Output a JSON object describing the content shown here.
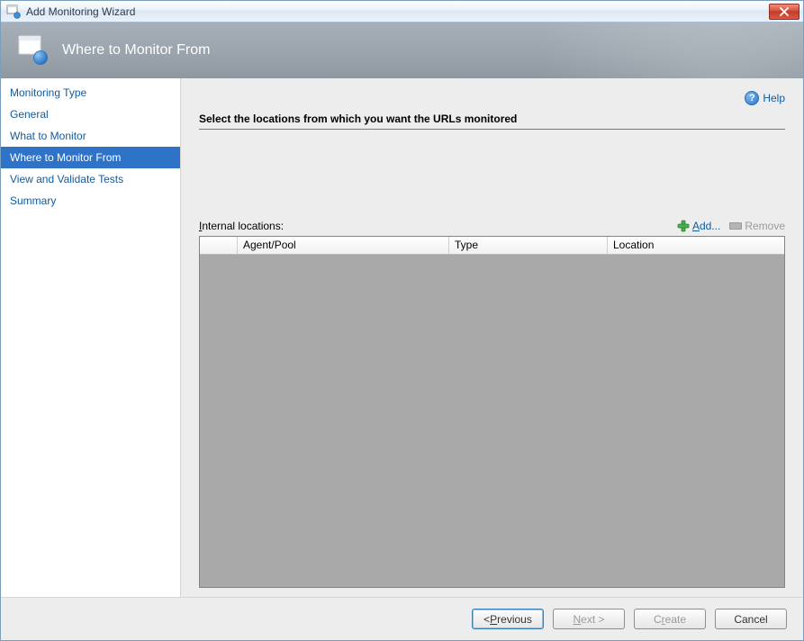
{
  "window": {
    "title": "Add Monitoring Wizard"
  },
  "banner": {
    "title": "Where to Monitor From"
  },
  "sidebar": {
    "items": [
      {
        "label": "Monitoring Type",
        "selected": false
      },
      {
        "label": "General",
        "selected": false
      },
      {
        "label": "What to Monitor",
        "selected": false
      },
      {
        "label": "Where to Monitor From",
        "selected": true
      },
      {
        "label": "View and Validate Tests",
        "selected": false
      },
      {
        "label": "Summary",
        "selected": false
      }
    ]
  },
  "help": {
    "label": "Help"
  },
  "main": {
    "instruction": "Select the locations from which you want the URLs monitored",
    "list_label_prefix": "I",
    "list_label_rest": "nternal locations:",
    "add_prefix": "A",
    "add_rest": "dd...",
    "remove_label": "Remove",
    "columns": {
      "agent": "Agent/Pool",
      "type": "Type",
      "location": "Location"
    }
  },
  "footer": {
    "previous_prefix": "< ",
    "previous_key": "P",
    "previous_rest": "revious",
    "next_prefix": "",
    "next_key": "N",
    "next_rest": "ext >",
    "create_prefix": "C",
    "create_key": "r",
    "create_rest": "eate",
    "cancel": "Cancel"
  }
}
